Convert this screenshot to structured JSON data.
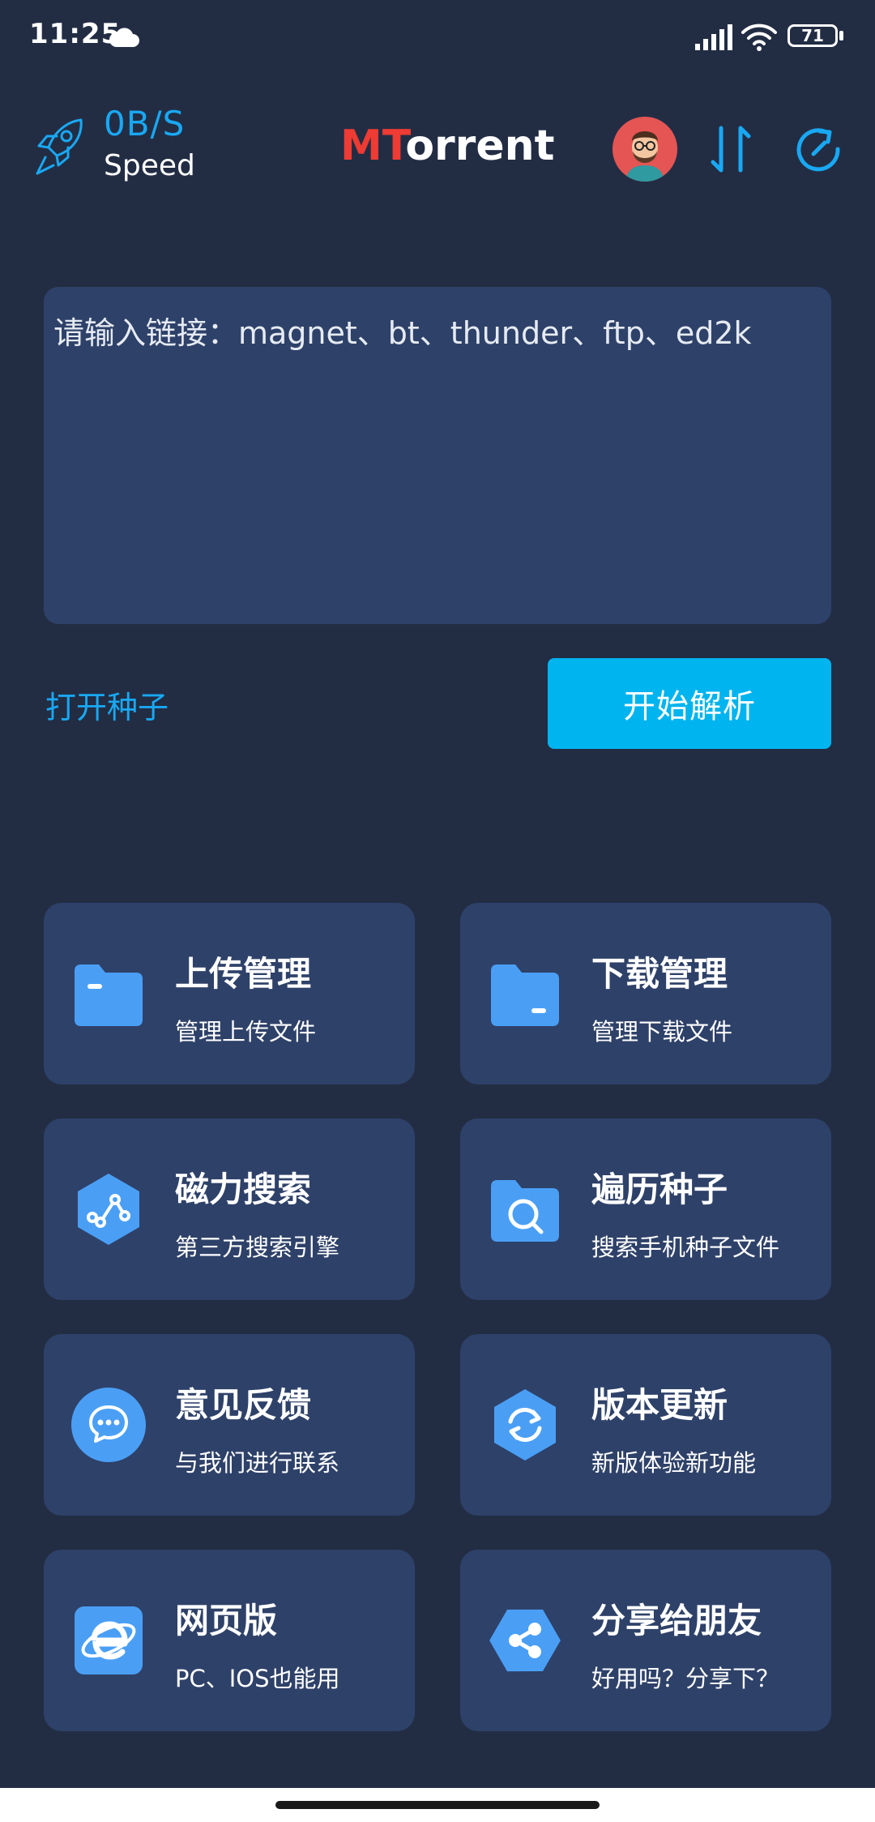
{
  "status_bar": {
    "time": "11:25",
    "battery": "71"
  },
  "header": {
    "speed_value": "0B/S",
    "speed_label": "Speed",
    "title_accent": "MT",
    "title_rest": "orrent"
  },
  "input": {
    "placeholder": "请输入链接：magnet、bt、thunder、ftp、ed2k",
    "value": ""
  },
  "actions": {
    "open_torrent": "打开种子",
    "start_parse": "开始解析"
  },
  "tiles": [
    {
      "title": "上传管理",
      "subtitle": "管理上传文件",
      "icon": "folder-upload-icon"
    },
    {
      "title": "下载管理",
      "subtitle": "管理下载文件",
      "icon": "folder-download-icon"
    },
    {
      "title": "磁力搜索",
      "subtitle": "第三方搜索引擎",
      "icon": "magnet-search-icon"
    },
    {
      "title": "遍历种子",
      "subtitle": "搜索手机种子文件",
      "icon": "folder-search-icon"
    },
    {
      "title": "意见反馈",
      "subtitle": "与我们进行联系",
      "icon": "chat-bubble-icon"
    },
    {
      "title": "版本更新",
      "subtitle": "新版体验新功能",
      "icon": "refresh-hex-icon"
    },
    {
      "title": "网页版",
      "subtitle": "PC、IOS也能用",
      "icon": "browser-e-icon"
    },
    {
      "title": "分享给朋友",
      "subtitle": "好用吗？分享下？",
      "icon": "share-icon"
    }
  ],
  "colors": {
    "background": "#222d44",
    "card": "#2e4169",
    "accent": "#19a8f3",
    "button": "#00b4ef",
    "icon_blue": "#4a9ff5",
    "brand_red": "#ee3b33"
  }
}
